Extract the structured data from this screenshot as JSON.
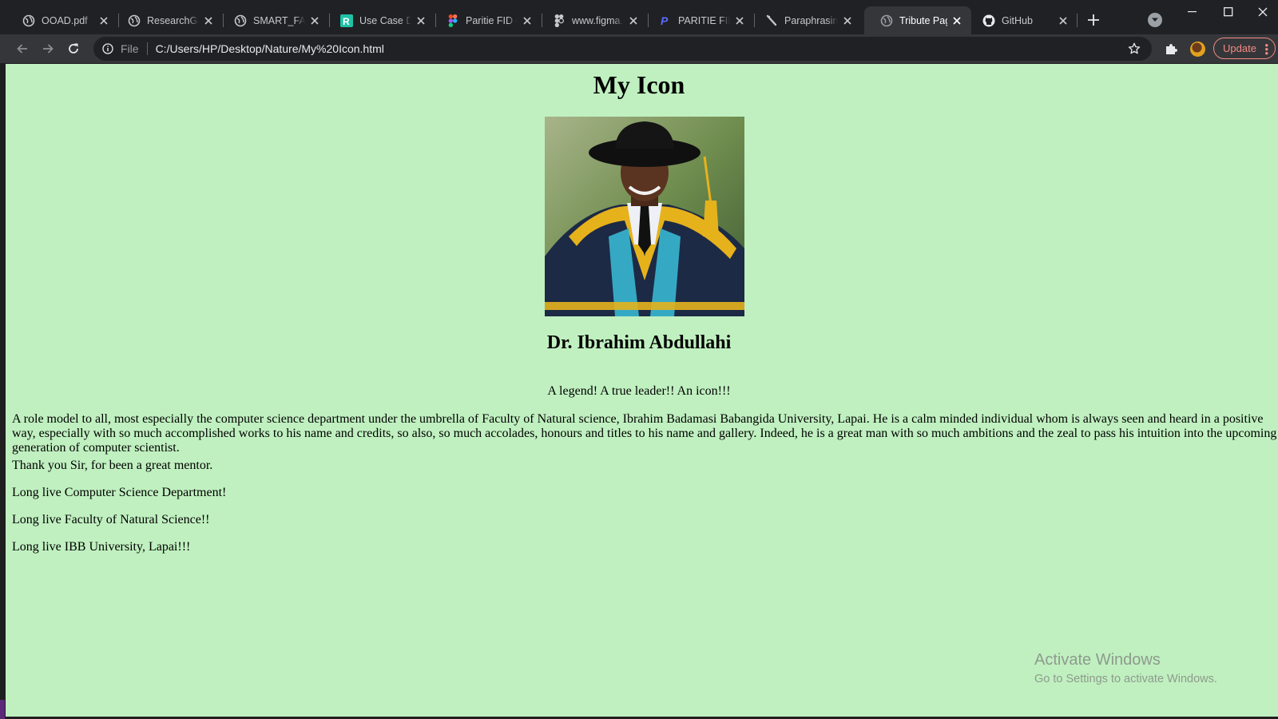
{
  "browser": {
    "tabs": [
      {
        "title": "OOAD.pdf",
        "favicon": "globe-icon",
        "active": false
      },
      {
        "title": "ResearchGate",
        "favicon": "globe-icon",
        "active": false
      },
      {
        "title": "SMART_FARM",
        "favicon": "globe-icon",
        "active": false
      },
      {
        "title": "Use Case Diagram",
        "favicon": "creately-icon",
        "active": false
      },
      {
        "title": "Paritie FID – Figma",
        "favicon": "figma-icon",
        "active": false
      },
      {
        "title": "www.figma.com",
        "favicon": "figma-icon",
        "active": false
      },
      {
        "title": "PARITIE FID",
        "favicon": "paypal-icon",
        "active": false
      },
      {
        "title": "Paraphrasing Tool",
        "favicon": "quill-icon",
        "active": false
      },
      {
        "title": "Tribute Page",
        "favicon": "globe-icon",
        "active": true
      },
      {
        "title": "GitHub",
        "favicon": "github-icon",
        "active": false
      }
    ],
    "address": {
      "scheme_label": "File",
      "url": "C:/Users/HP/Desktop/Nature/My%20Icon.html"
    },
    "update_label": "Update",
    "colors": {
      "tabstrip": "#202124",
      "toolbar": "#35363a",
      "update": "#f28b82"
    }
  },
  "page": {
    "title": "My Icon",
    "image": {
      "alt": "Portrait of Dr. Ibrahim Abdullahi in academic gown and cap"
    },
    "name": "Dr. Ibrahim Abdullahi",
    "tagline": "A legend! A true leader!! An icon!!!",
    "paragraphs": [
      "A role model to all, most especially the computer science department under the umbrella of Faculty of Natural science, Ibrahim Badamasi Babangida University, Lapai. He is a calm minded individual whom is always seen and heard in a positive way, especially with so much accomplished works to his name and credits, so also, so much accolades, honours and titles to his name and gallery. Indeed, he is a great man with so much ambitions and the zeal to pass his intuition into the upcoming generation of computer scientist.",
      "Thank you Sir, for been a great mentor.",
      "Long live Computer Science Department!",
      "Long live Faculty of Natural Science!!",
      "Long live IBB University, Lapai!!!"
    ],
    "background": "#c0f0c0"
  },
  "watermark": {
    "line1": "Activate Windows",
    "line2": "Go to Settings to activate Windows."
  }
}
